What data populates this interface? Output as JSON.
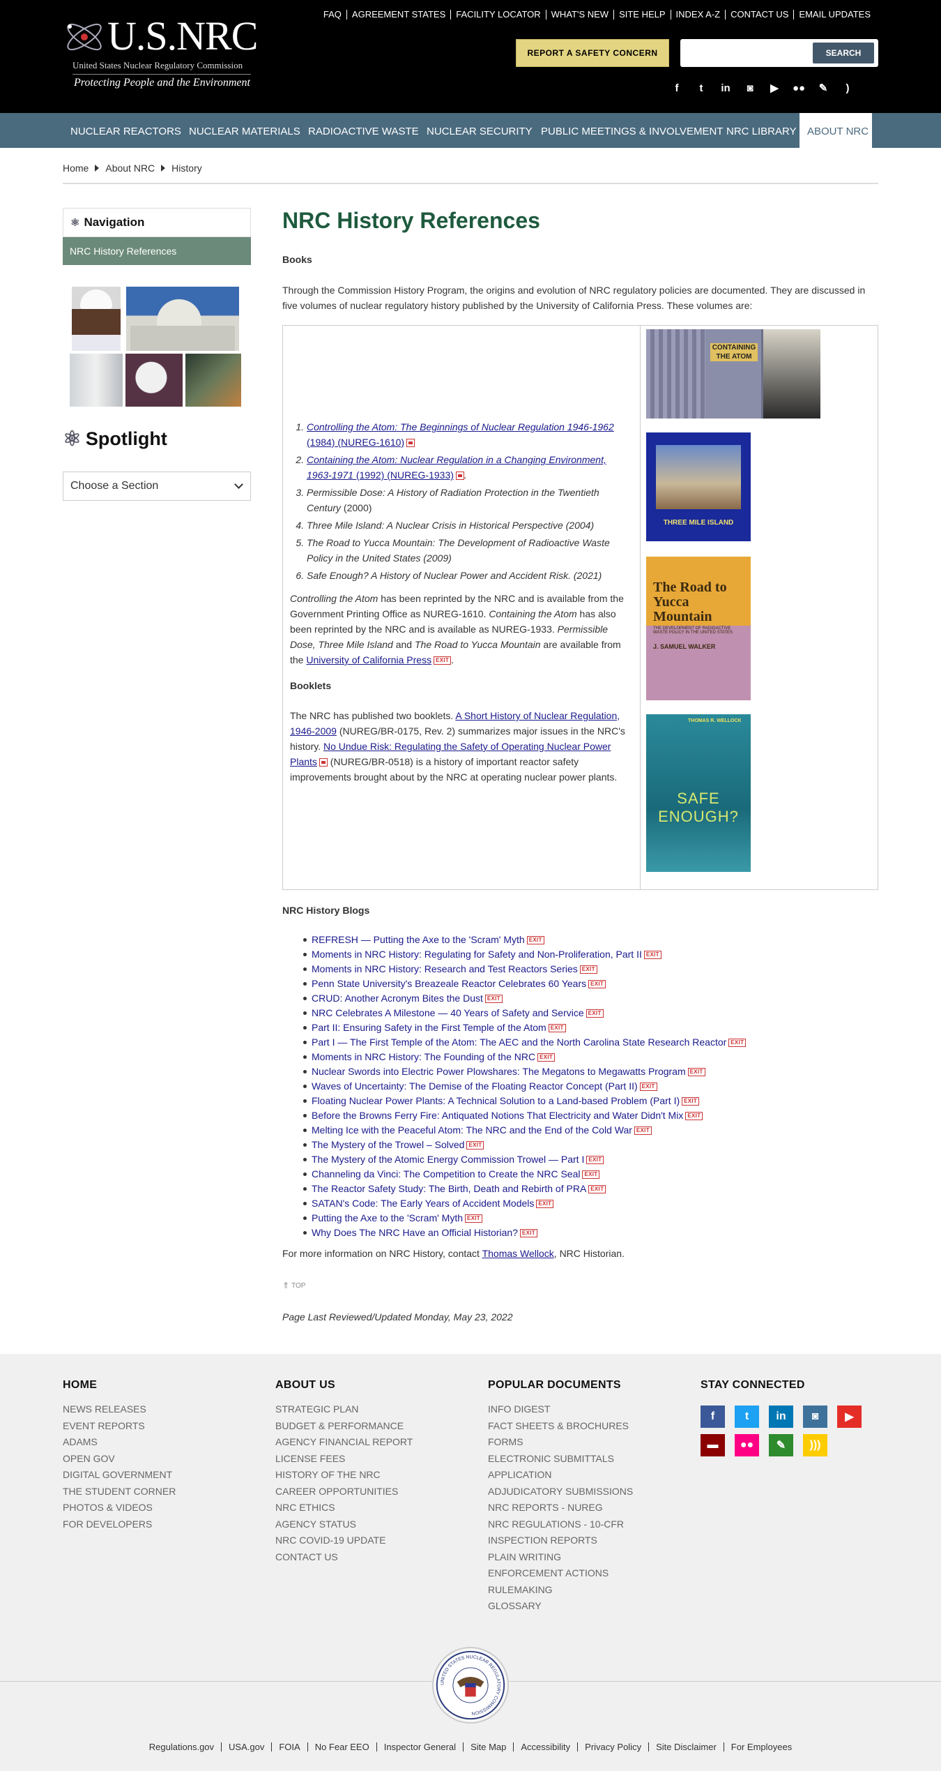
{
  "header": {
    "logo_title": "U.S.NRC",
    "logo_subtitle": "United States Nuclear Regulatory Commission",
    "logo_tagline": "Protecting People and the Environment",
    "utility_links": [
      "FAQ",
      "AGREEMENT STATES",
      "FACILITY LOCATOR",
      "WHAT'S NEW",
      "SITE HELP",
      "INDEX A-Z",
      "CONTACT US",
      "EMAIL UPDATES"
    ],
    "report_button": "REPORT A SAFETY CONCERN",
    "search_placeholder": "",
    "search_button": "SEARCH",
    "social_icons": [
      "facebook-icon",
      "twitter-icon",
      "linkedin-icon",
      "instagram-icon",
      "youtube-icon",
      "flickr-icon",
      "blog-icon",
      "rss-icon"
    ]
  },
  "main_nav": {
    "items": [
      "NUCLEAR REACTORS",
      "NUCLEAR MATERIALS",
      "RADIOACTIVE WASTE",
      "NUCLEAR SECURITY",
      "PUBLIC MEETINGS & INVOLVEMENT",
      "NRC LIBRARY",
      "ABOUT NRC"
    ],
    "active": "ABOUT NRC"
  },
  "breadcrumb": [
    "Home",
    "About NRC",
    "History"
  ],
  "sidebar": {
    "nav_title": "Navigation",
    "nav_item": "NRC History References",
    "spotlight_title": "Spotlight",
    "section_select": "Choose a Section"
  },
  "main": {
    "title": "NRC History References",
    "books_heading": "Books",
    "intro": "Through the Commission History Program, the origins and evolution of NRC regulatory policies are documented. They are discussed in five volumes of nuclear regulatory history published by the University of California Press. These volumes are:",
    "books": [
      {
        "title": "Controlling the Atom: The Beginnings of Nuclear Regulation 1946-1962",
        "plain": "",
        "link2": "(1984) (NUREG-1610)",
        "linked": true
      },
      {
        "title": "Containing the Atom: Nuclear Regulation in a Changing Environment, 1963-1971",
        "plain": "",
        "link2": "(1992) (NUREG-1933)",
        "linked": true
      },
      {
        "title": "Permissible Dose: A History of Radiation Protection in the Twentieth Century",
        "plain": "(2000)",
        "linked": false
      },
      {
        "title": "Three Mile Island: A Nuclear Crisis in Historical Perspective (2004)",
        "plain": "",
        "linked": false
      },
      {
        "title": "The Road to Yucca Mountain: The Development of Radioactive Waste Policy in the United States (2009)",
        "plain": "",
        "linked": false
      },
      {
        "title": "Safe Enough? A History of Nuclear Power and Accident Risk. (2021)",
        "plain": "",
        "linked": false
      }
    ],
    "reprint": {
      "t1": "Controlling the Atom",
      "t2": " has been reprinted by the NRC and is available from the Government Printing Office as NUREG-1610. ",
      "t3": "Containing the Atom",
      "t4": " has also been reprinted by the NRC and is available as NUREG-1933. ",
      "t5": "Permissible Dose, Three Mile Island",
      "t6": " and ",
      "t7": "The Road to Yucca Mountain",
      "t8": " are available from the ",
      "link": "University of California Press",
      "t9": "."
    },
    "booklets_heading": "Booklets",
    "booklets": {
      "t1": "The NRC has published two booklets. ",
      "link1": "A Short History of Nuclear Regulation, 1946-2009",
      "t2": " (NUREG/BR-0175, Rev. 2) summarizes major issues in the NRC's history. ",
      "link2": "No Undue Risk: Regulating the Safety of Operating Nuclear Power Plants",
      "t3": " (NUREG/BR-0518) is a history of important reactor safety improvements brought about by the NRC at operating nuclear power plants."
    },
    "covers": {
      "containing_title": "CONTAINING THE ATOM",
      "tmi_title": "THREE MILE ISLAND",
      "yucca_title": "The Road to Yucca Mountain",
      "yucca_sub": "THE DEVELOPMENT OF RADIOACTIVE WASTE POLICY IN THE UNITED STATES",
      "yucca_author": "J. SAMUEL WALKER",
      "safe_author": "THOMAS R. WELLOCK",
      "safe_title": "SAFE ENOUGH?"
    },
    "exit_label": "EXIT",
    "blogs_heading": "NRC History Blogs",
    "blogs": [
      "REFRESH — Putting the Axe to the 'Scram' Myth",
      "Moments in NRC History: Regulating for Safety and Non-Proliferation, Part II",
      "Moments in NRC History: Research and Test Reactors Series",
      "Penn State University's Breazeale Reactor Celebrates 60 Years",
      "CRUD: Another Acronym Bites the Dust",
      "NRC Celebrates A Milestone — 40 Years of Safety and Service",
      "Part II: Ensuring Safety in the First Temple of the Atom",
      "Part I — The First Temple of the Atom: The AEC and the North Carolina State Research Reactor",
      "Moments in NRC History: The Founding of the NRC",
      "Nuclear Swords into Electric Power Plowshares: The Megatons to Megawatts Program",
      "Waves of Uncertainty: The Demise of the Floating Reactor Concept (Part II)",
      "Floating Nuclear Power Plants: A Technical Solution to a Land-based Problem (Part I)",
      "Before the Browns Ferry Fire: Antiquated Notions That Electricity and Water Didn't Mix",
      "Melting Ice with the Peaceful Atom: The NRC and the End of the Cold War",
      "The Mystery of the Trowel – Solved",
      "The Mystery of the Atomic Energy Commission Trowel — Part I",
      "Channeling da Vinci: The Competition to Create the NRC Seal",
      "The Reactor Safety Study: The Birth, Death and Rebirth of PRA",
      "SATAN's Code: The Early Years of Accident Models",
      "Putting the Axe to the 'Scram' Myth",
      "Why Does The NRC Have an Official Historian?"
    ],
    "contact_pre": "For more information on NRC History, contact ",
    "contact_link": "Thomas Wellock",
    "contact_post": ", NRC Historian.",
    "top_link": "TOP",
    "last_reviewed": "Page Last Reviewed/Updated Monday, May 23, 2022"
  },
  "footer": {
    "home": {
      "heading": "HOME",
      "links": [
        "NEWS RELEASES",
        "EVENT REPORTS",
        "ADAMS",
        "OPEN GOV",
        "DIGITAL GOVERNMENT",
        "THE STUDENT CORNER",
        "PHOTOS & VIDEOS",
        "FOR DEVELOPERS"
      ]
    },
    "about": {
      "heading": "ABOUT US",
      "links": [
        "STRATEGIC PLAN",
        "BUDGET & PERFORMANCE",
        "AGENCY FINANCIAL REPORT",
        "LICENSE FEES",
        "HISTORY OF THE NRC",
        "CAREER OPPORTUNITIES",
        "NRC ETHICS",
        "AGENCY STATUS",
        "NRC COVID-19 UPDATE",
        "CONTACT US"
      ]
    },
    "popular": {
      "heading": "POPULAR DOCUMENTS",
      "links": [
        "INFO DIGEST",
        "FACT SHEETS & BROCHURES",
        "FORMS",
        "ELECTRONIC SUBMITTALS",
        "APPLICATION",
        "ADJUDICATORY SUBMISSIONS",
        "NRC REPORTS - NUREG",
        "NRC REGULATIONS - 10-CFR",
        "INSPECTION REPORTS",
        "PLAIN WRITING",
        "ENFORCEMENT ACTIONS",
        "RULEMAKING",
        "GLOSSARY"
      ]
    },
    "connect_heading": "STAY CONNECTED",
    "social": [
      {
        "name": "facebook-icon",
        "color": "#3b5998",
        "glyph": "f"
      },
      {
        "name": "twitter-icon",
        "color": "#1da1f2",
        "glyph": "t"
      },
      {
        "name": "linkedin-icon",
        "color": "#0077b5",
        "glyph": "in"
      },
      {
        "name": "instagram-icon",
        "color": "#3f729b",
        "glyph": "◙"
      },
      {
        "name": "youtube-icon",
        "color": "#e52d27",
        "glyph": "▶"
      },
      {
        "name": "blog-icon",
        "color": "#8b0000",
        "glyph": "▬"
      },
      {
        "name": "flickr-icon",
        "color": "#ff0084",
        "glyph": "●●"
      },
      {
        "name": "edit-icon",
        "color": "#2e8b2e",
        "glyph": "✎"
      },
      {
        "name": "rss-icon",
        "color": "#ffcc00",
        "glyph": ")))"
      }
    ],
    "seal_text": "UNITED STATES NUCLEAR REGULATORY COMMISSION",
    "bottom_links": [
      "Regulations.gov",
      "USA.gov",
      "FOIA",
      "No Fear EEO",
      "Inspector General",
      "Site Map",
      "Accessibility",
      "Privacy Policy",
      "Site Disclaimer",
      "For Employees"
    ]
  },
  "colors": {
    "header_bg": "#000000",
    "nav_bg": "#4a6a7e",
    "title_green": "#1e5a3e",
    "report_yellow": "#e3d482",
    "sidenav_active": "#6c8a7a",
    "exit_red": "#cc3333"
  }
}
